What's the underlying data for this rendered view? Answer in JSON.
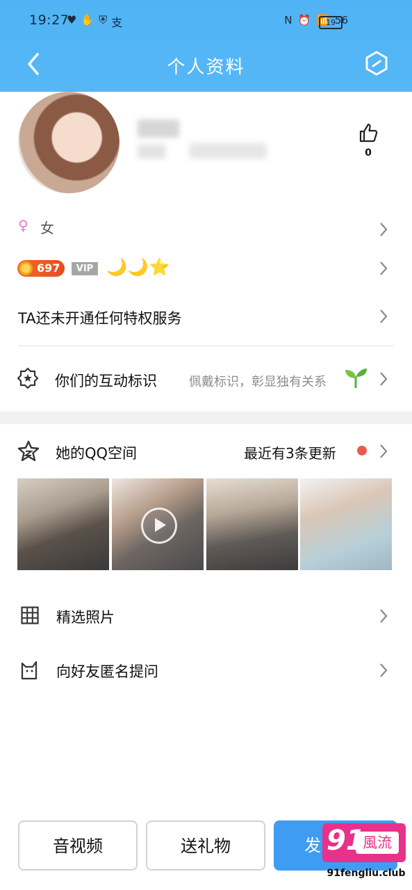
{
  "status_bar": {
    "time": "19:27",
    "left_icons": [
      "heart-icon",
      "hand-icon",
      "shield-icon",
      "alipay-icon"
    ],
    "right_icons": [
      "nfc-icon",
      "alarm-icon",
      "wifi-icon",
      "signal-icon"
    ],
    "signal_label": "56",
    "battery_level": "19"
  },
  "nav": {
    "title": "个人资料",
    "back_icon": "back-arrow-icon",
    "edit_icon": "edit-icon"
  },
  "profile": {
    "like_count": "0"
  },
  "gender": {
    "symbol": "♀",
    "label": "女"
  },
  "badges": {
    "coin_value": "697",
    "vip_label": "VIP",
    "level_icons": "🌙🌙⭐"
  },
  "privilege": {
    "text": "TA还未开通任何特权服务"
  },
  "interaction": {
    "label": "你们的互动标识",
    "sub": "佩戴标识，彰显独有关系"
  },
  "qzone": {
    "label": "她的QQ空间",
    "update": "最近有3条更新"
  },
  "menu": {
    "featured_photos": "精选照片",
    "anonymous_ask": "向好友匿名提问"
  },
  "bottom": {
    "audio_video": "音视频",
    "gift": "送礼物",
    "send_message": "发"
  },
  "watermark": {
    "number": "91",
    "brand": "風流",
    "url": "91fengliu.club"
  },
  "colors": {
    "header": "#55b6f6",
    "primary": "#3f9cf3",
    "watermark": "#e8318a",
    "dot": "#e85b4f"
  }
}
